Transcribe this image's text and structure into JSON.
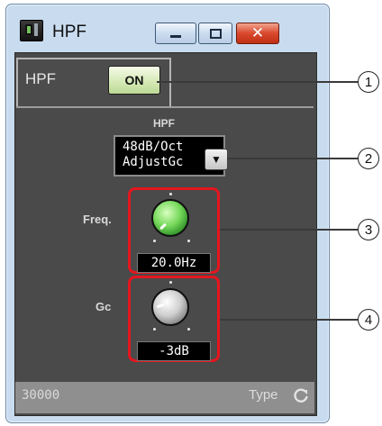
{
  "window": {
    "title": "HPF",
    "controls": {
      "minimize": "minimize",
      "maximize": "maximize",
      "close": "✕"
    }
  },
  "hpf_panel": {
    "tab_label": "HPF",
    "on_button_label": "ON"
  },
  "filter_type": {
    "label": "HPF",
    "value_line1": "48dB/Oct",
    "value_line2": "AdjustGc"
  },
  "freq": {
    "label": "Freq.",
    "value": "20.0Hz"
  },
  "gc": {
    "label": "Gc",
    "value": "-3dB"
  },
  "status_bar": {
    "id": "30000",
    "type_label": "Type"
  },
  "callouts": [
    "1",
    "2",
    "3",
    "4"
  ],
  "colors": {
    "highlight": "#e4161e",
    "knob_freq": "#75d85a",
    "panel": "#4a4a4a"
  },
  "icons": [
    "app-icon",
    "minimize-icon",
    "maximize-icon",
    "close-icon",
    "dropdown-arrow-icon",
    "refresh-icon"
  ]
}
